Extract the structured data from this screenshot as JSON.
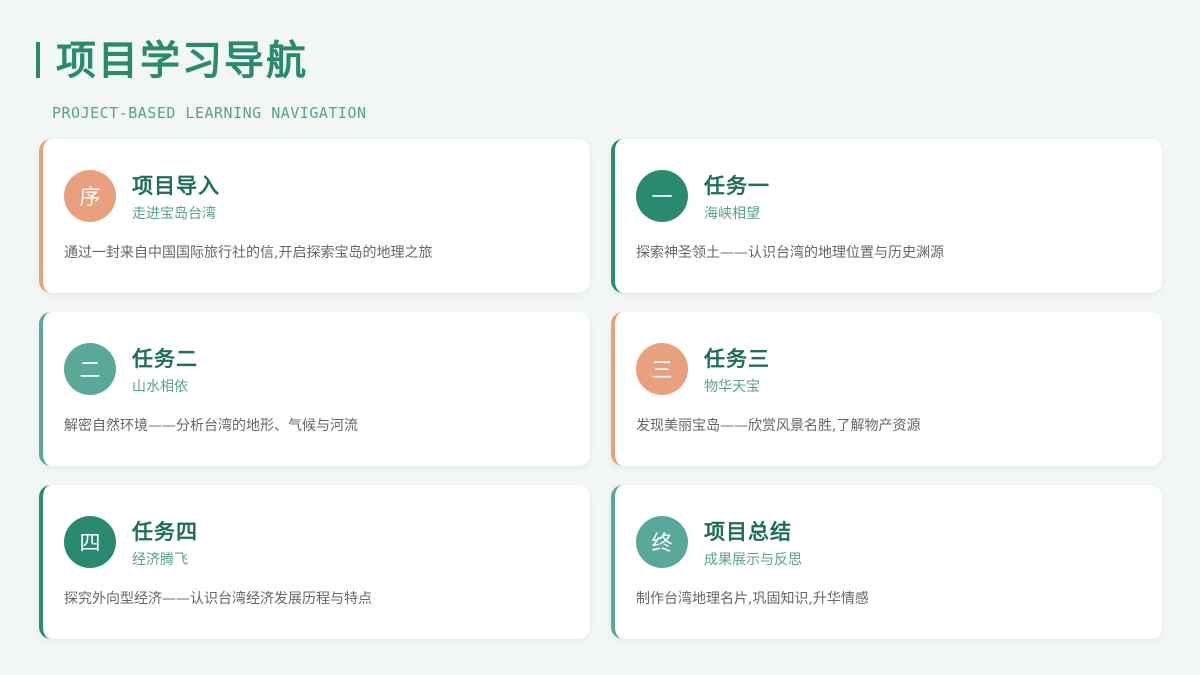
{
  "header": {
    "title": "项目学习导航",
    "subtitle": "PROJECT-BASED LEARNING NAVIGATION"
  },
  "cards": [
    {
      "badge": "序",
      "title": "项目导入",
      "subtitle": "走进宝岛台湾",
      "description": "通过一封来自中国国际旅行社的信,开启探索宝岛的地理之旅",
      "accent": "#e9a07e"
    },
    {
      "badge": "一",
      "title": "任务一",
      "subtitle": "海峡相望",
      "description": "探索神圣领土——认识台湾的地理位置与历史渊源",
      "accent": "#2a8a6e"
    },
    {
      "badge": "二",
      "title": "任务二",
      "subtitle": "山水相依",
      "description": "解密自然环境——分析台湾的地形、气候与河流",
      "accent": "#5aa89a"
    },
    {
      "badge": "三",
      "title": "任务三",
      "subtitle": "物华天宝",
      "description": "发现美丽宝岛——欣赏风景名胜,了解物产资源",
      "accent": "#e9a07e"
    },
    {
      "badge": "四",
      "title": "任务四",
      "subtitle": "经济腾飞",
      "description": "探究外向型经济——认识台湾经济发展历程与特点",
      "accent": "#2a8a6e"
    },
    {
      "badge": "终",
      "title": "项目总结",
      "subtitle": "成果展示与反思",
      "description": "制作台湾地理名片,巩固知识,升华情感",
      "accent": "#5aa89a"
    }
  ]
}
